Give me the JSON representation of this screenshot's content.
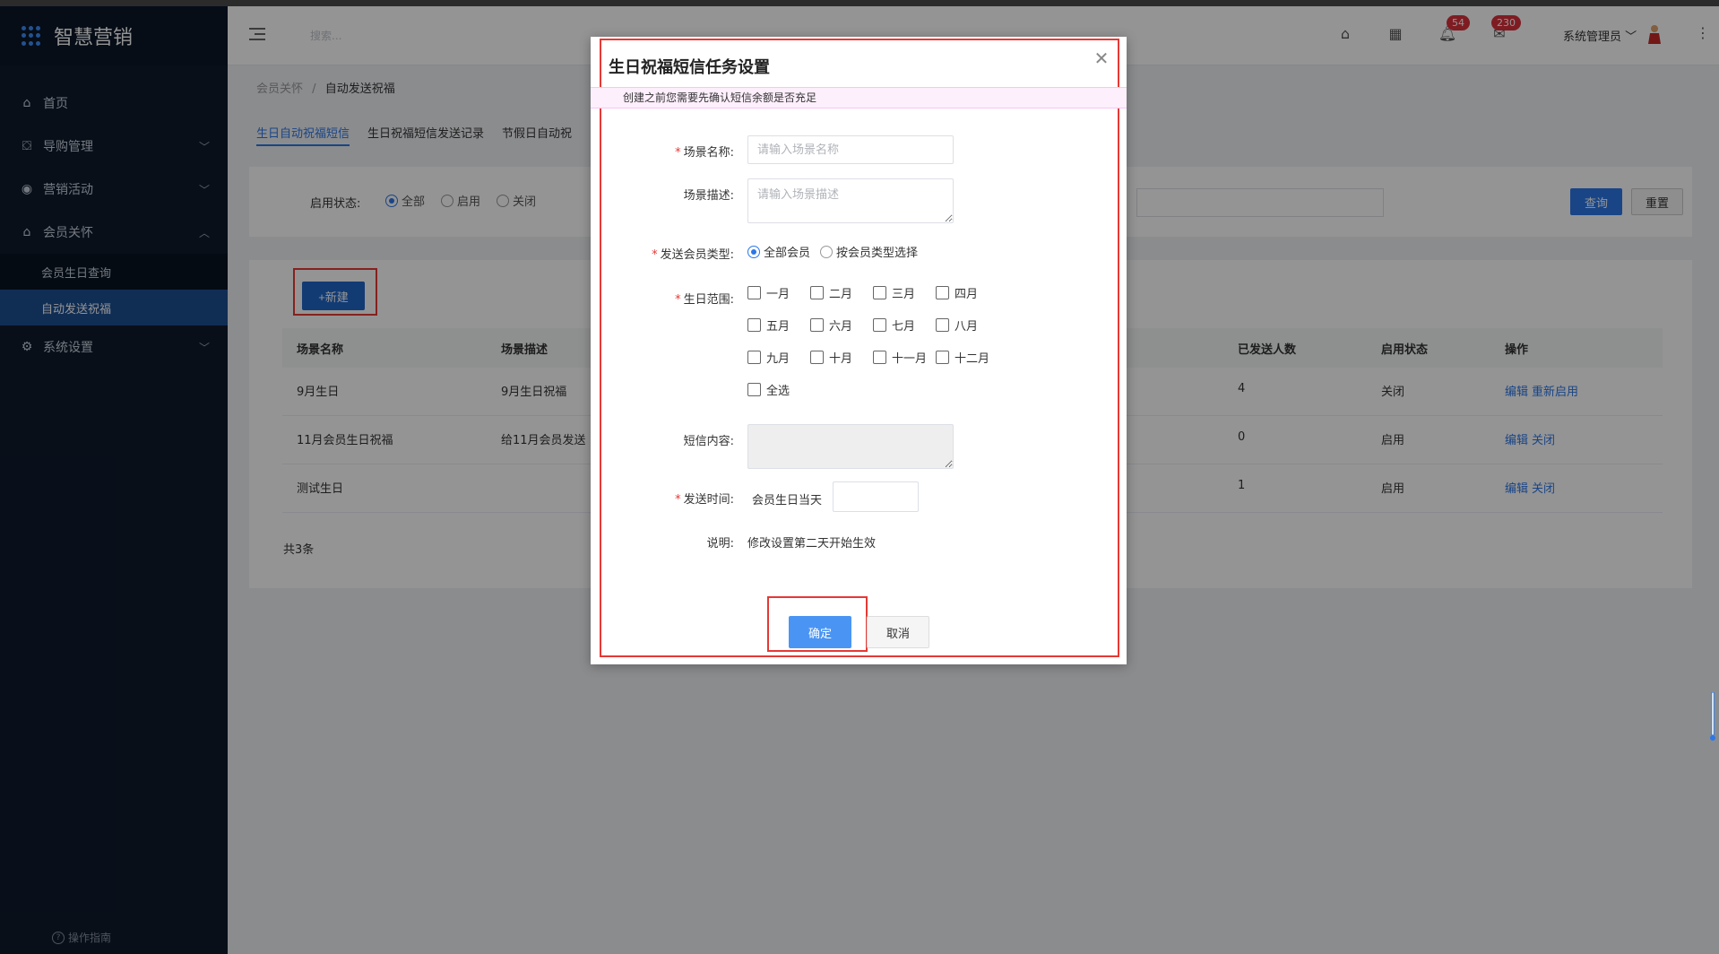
{
  "app": {
    "brand": "智慧营销",
    "colors": {
      "sidebar_bg": "#0e1a2c",
      "accent": "#2b77e8",
      "danger": "#e53935"
    }
  },
  "sidebar": {
    "items": [
      {
        "label": "首页",
        "icon": "home-icon"
      },
      {
        "label": "导购管理",
        "icon": "bag-icon"
      },
      {
        "label": "营销活动",
        "icon": "coins-icon"
      },
      {
        "label": "会员关怀",
        "icon": "home-icon"
      },
      {
        "label": "系统设置",
        "icon": "gear-icon"
      }
    ],
    "sub_items": [
      {
        "label": "会员生日查询"
      },
      {
        "label": "自动发送祝福"
      }
    ],
    "guide_label": "操作指南"
  },
  "header": {
    "search_placeholder": "搜索...",
    "notify_count": "54",
    "message_count": "230",
    "user_name": "系统管理员"
  },
  "breadcrumb": {
    "parent": "会员关怀",
    "sep": "/",
    "current": "自动发送祝福"
  },
  "tabs": [
    {
      "label": "生日自动祝福短信"
    },
    {
      "label": "生日祝福短信发送记录"
    },
    {
      "label": "节假日自动祝"
    }
  ],
  "filter": {
    "label": "启用状态:",
    "options": [
      "全部",
      "启用",
      "关闭"
    ],
    "query_label": "查询",
    "reset_label": "重置"
  },
  "list": {
    "new_label": "+新建",
    "columns": [
      "场景名称",
      "场景描述",
      "已发送人数",
      "启用状态",
      "操作"
    ],
    "rows": [
      {
        "name": "9月生日",
        "desc": "9月生日祝福",
        "sent": "4",
        "status": "关闭",
        "actions": [
          "编辑",
          "重新启用"
        ]
      },
      {
        "name": "11月会员生日祝福",
        "desc": "给11月会员发送",
        "sent": "0",
        "status": "启用",
        "actions": [
          "编辑",
          "关闭"
        ]
      },
      {
        "name": "测试生日",
        "desc": "",
        "sent": "1",
        "status": "启用",
        "actions": [
          "编辑",
          "关闭"
        ]
      }
    ],
    "total": "共3条"
  },
  "modal": {
    "title": "生日祝福短信任务设置",
    "notice": "创建之前您需要先确认短信余额是否充足",
    "scene_name_label": "场景名称:",
    "scene_name_placeholder": "请输入场景名称",
    "scene_desc_label": "场景描述:",
    "scene_desc_placeholder": "请输入场景描述",
    "member_type_label": "发送会员类型:",
    "member_type_options": [
      "全部会员",
      "按会员类型选择"
    ],
    "birthday_range_label": "生日范围:",
    "months": [
      "一月",
      "二月",
      "三月",
      "四月",
      "五月",
      "六月",
      "七月",
      "八月",
      "九月",
      "十月",
      "十一月",
      "十二月"
    ],
    "select_all": "全选",
    "sms_content_label": "短信内容:",
    "send_time_label": "发送时间:",
    "send_time_prefix": "会员生日当天",
    "note_label": "说明:",
    "note_text": "修改设置第二天开始生效",
    "ok_label": "确定",
    "cancel_label": "取消"
  }
}
